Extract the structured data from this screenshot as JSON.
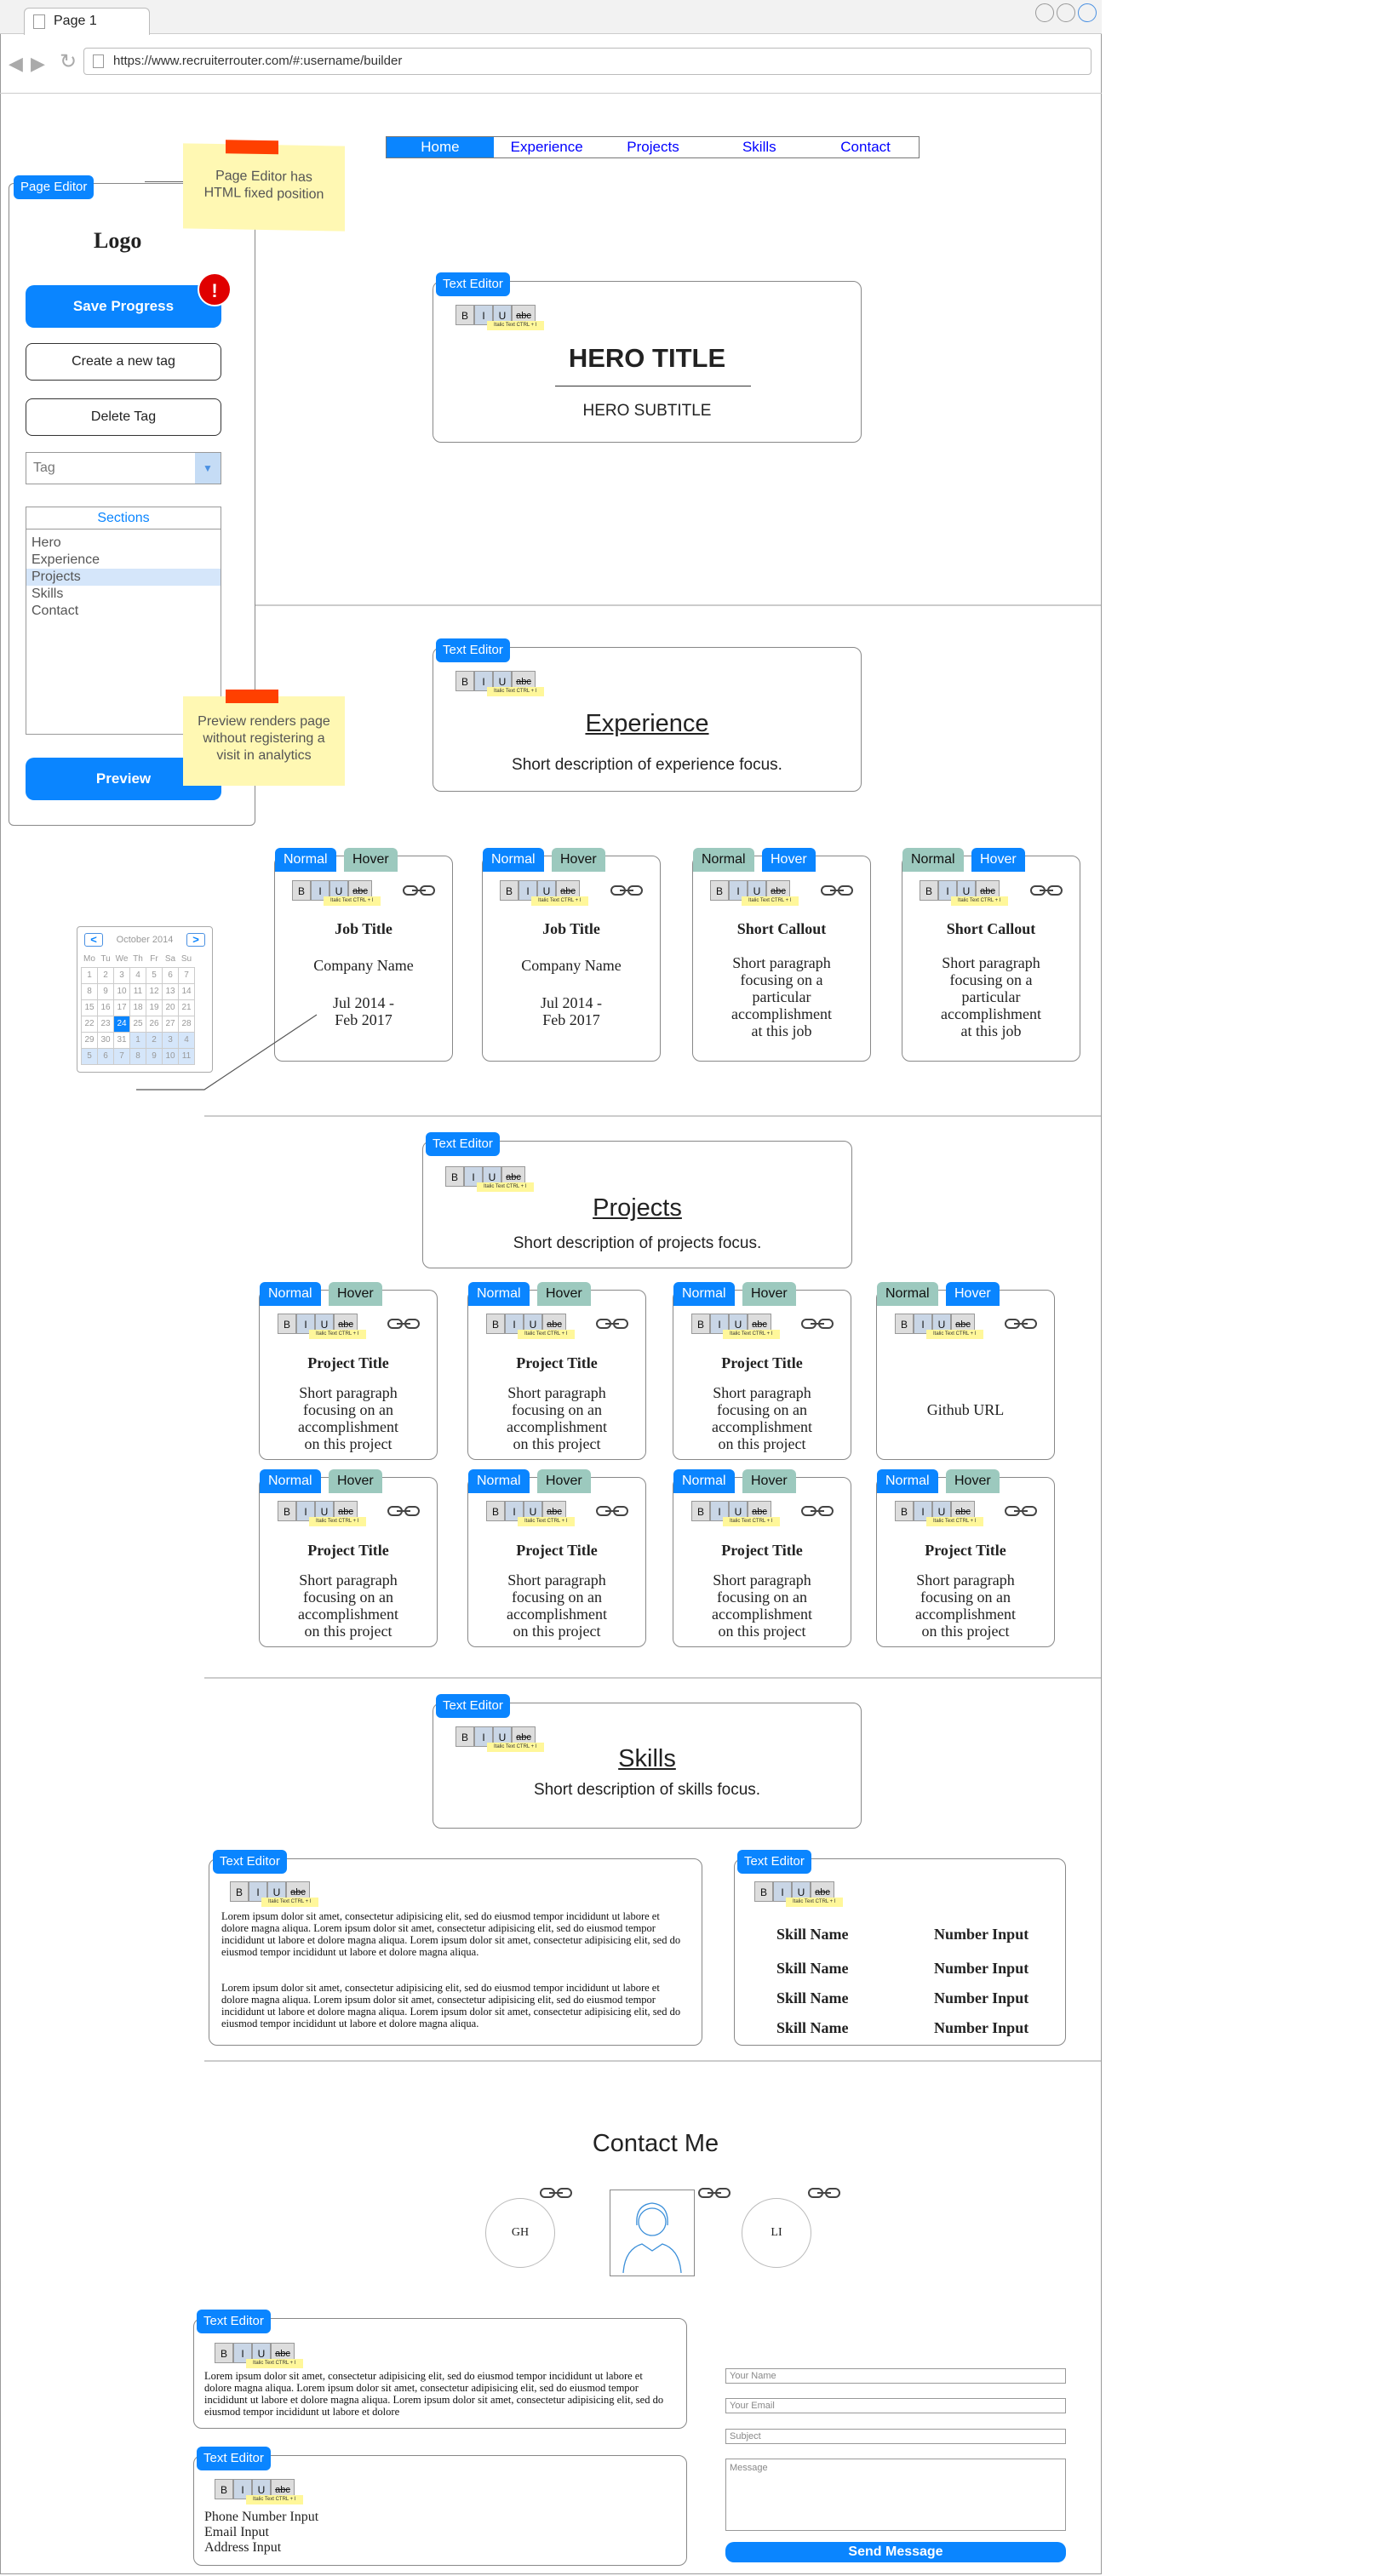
{
  "browser": {
    "tab_title": "Page 1",
    "url": "https://www.recruiterrouter.com/#:username/builder"
  },
  "nav": {
    "items": [
      "Home",
      "Experience",
      "Projects",
      "Skills",
      "Contact"
    ]
  },
  "editor": {
    "panel_label": "Page Editor",
    "logo": "Logo",
    "save": "Save Progress",
    "alert": "!",
    "create_tag": "Create a new tag",
    "delete_tag": "Delete Tag",
    "tag_placeholder": "Tag",
    "sections_title": "Sections",
    "sections": [
      "Hero",
      "Experience",
      "Projects",
      "Skills",
      "Contact"
    ],
    "preview": "Preview"
  },
  "notes": {
    "fixed": "Page Editor has HTML fixed position",
    "preview": "Preview renders page without registering a visit in analytics"
  },
  "common": {
    "text_editor": "Text Editor",
    "normal": "Normal",
    "hover": "Hover",
    "bold": "B",
    "italic": "I",
    "underline": "U",
    "strike": "abc",
    "tooltip": "Italic Text CTRL + I"
  },
  "hero": {
    "title": "HERO TITLE",
    "subtitle": "HERO SUBTITLE"
  },
  "experience": {
    "title": "Experience",
    "desc": "Short description of experience focus.",
    "cards": [
      {
        "title": "Job Title",
        "line1": "Company Name",
        "line2": "Jul 2014 -",
        "line3": "Feb 2017"
      },
      {
        "title": "Job Title",
        "line1": "Company Name",
        "line2": "Jul 2014 -",
        "line3": "Feb 2017"
      },
      {
        "title": "Short Callout",
        "text": [
          "Short paragraph",
          "focusing on a",
          "particular",
          "accomplishment",
          "at this job"
        ]
      },
      {
        "title": "Short Callout",
        "text": [
          "Short paragraph",
          "focusing on a",
          "particular",
          "accomplishment",
          "at this job"
        ]
      }
    ]
  },
  "calendar": {
    "month": "October 2014",
    "prev": "<",
    "next": ">",
    "days": [
      "Mo",
      "Tu",
      "We",
      "Th",
      "Fr",
      "Sa",
      "Su"
    ],
    "rows": [
      [
        "1",
        "2",
        "3",
        "4",
        "5",
        "6",
        "7"
      ],
      [
        "8",
        "9",
        "10",
        "11",
        "12",
        "13",
        "14"
      ],
      [
        "15",
        "16",
        "17",
        "18",
        "19",
        "20",
        "21"
      ],
      [
        "22",
        "23",
        "24",
        "25",
        "26",
        "27",
        "28"
      ],
      [
        "29",
        "30",
        "31",
        "1",
        "2",
        "3",
        "4"
      ],
      [
        "5",
        "6",
        "7",
        "8",
        "9",
        "10",
        "11"
      ]
    ],
    "selected": "24"
  },
  "projects": {
    "title": "Projects",
    "desc": "Short description of projects focus.",
    "card_title": "Project Title",
    "card_text": [
      "Short paragraph",
      "focusing on an",
      "accomplishment",
      "on this project"
    ],
    "github": "Github URL"
  },
  "skills": {
    "title": "Skills",
    "desc": "Short description of skills focus.",
    "lorem": "Lorem ipsum dolor sit amet, consectetur adipisicing elit, sed do eiusmod tempor incididunt ut labore et dolore magna aliqua. Lorem ipsum dolor sit amet, consectetur adipisicing elit, sed do eiusmod tempor incididunt ut labore et dolore magna aliqua. Lorem ipsum dolor sit amet, consectetur adipisicing elit, sed do eiusmod tempor incididunt ut labore et dolore magna aliqua.",
    "skill_name": "Skill Name",
    "number_input": "Number Input"
  },
  "contact": {
    "title": "Contact Me",
    "gh": "GH",
    "li": "LI",
    "lorem": "Lorem ipsum dolor sit amet, consectetur adipisicing elit, sed do eiusmod tempor incididunt ut labore et dolore magna aliqua. Lorem ipsum dolor sit amet, consectetur adipisicing elit, sed do eiusmod tempor incididunt ut labore et dolore magna aliqua. Lorem ipsum dolor sit amet, consectetur adipisicing elit, sed do eiusmod tempor incididunt ut labore et dolore",
    "phone": "Phone Number Input",
    "email": "Email Input",
    "address": "Address Input",
    "form": {
      "name": "Your Name",
      "email": "Your Email",
      "subject": "Subject",
      "message": "Message",
      "send": "Send Message"
    }
  },
  "colors": {
    "accent": "#0a85ff",
    "tab_green": "#9cc9be",
    "note": "#fff8b3",
    "alert": "#e00000"
  }
}
